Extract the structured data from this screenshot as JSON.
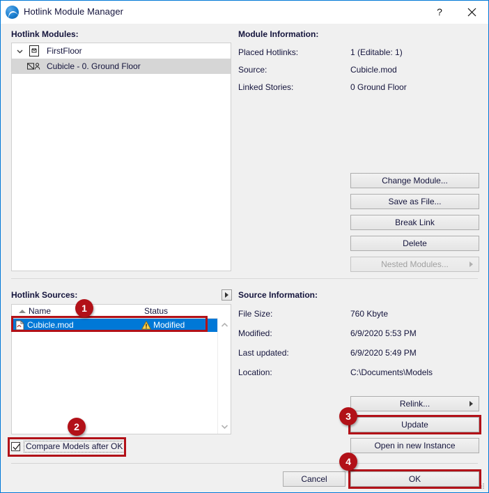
{
  "window": {
    "title": "Hotlink Module Manager",
    "icon": "archicad-logo-icon",
    "help_label": "?",
    "close_label": "✕"
  },
  "modules_panel": {
    "heading": "Hotlink Modules:",
    "tree": [
      {
        "label": "FirstFloor",
        "icon": "module-file-icon",
        "expanded": true,
        "selected": false
      },
      {
        "label": "Cubicle - 0. Ground Floor",
        "icon": "hotlink-instance-icon",
        "expanded": false,
        "selected": true
      }
    ]
  },
  "module_information": {
    "heading": "Module Information:",
    "rows": [
      {
        "label": "Placed Hotlinks:",
        "value": "1 (Editable: 1)"
      },
      {
        "label": "Source:",
        "value": "Cubicle.mod"
      },
      {
        "label": "Linked Stories:",
        "value": "0 Ground Floor"
      }
    ]
  },
  "module_buttons": [
    {
      "label": "Change Module...",
      "disabled": false,
      "caret": false
    },
    {
      "label": "Save as File...",
      "disabled": false,
      "caret": false
    },
    {
      "label": "Break Link",
      "disabled": false,
      "caret": false
    },
    {
      "label": "Delete",
      "disabled": false,
      "caret": false
    },
    {
      "label": "Nested Modules...",
      "disabled": true,
      "caret": true
    }
  ],
  "sources_panel": {
    "heading": "Hotlink Sources:",
    "expand_button": "expand-right-icon",
    "columns": [
      "Name",
      "Status"
    ],
    "sort_indicator": "sort-ascending-icon",
    "rows": [
      {
        "name": "Cubicle.mod",
        "status": "Modified",
        "status_icon": "warning-triangle-icon",
        "file_icon": "mod-file-icon",
        "selected": true
      }
    ],
    "scroll_up": "chevron-up-icon",
    "scroll_down": "chevron-down-icon"
  },
  "source_information": {
    "heading": "Source Information:",
    "rows": [
      {
        "label": "File Size:",
        "value": "760 Kbyte"
      },
      {
        "label": "Modified:",
        "value": "6/9/2020 5:53 PM"
      },
      {
        "label": "Last updated:",
        "value": "6/9/2020 5:49 PM"
      },
      {
        "label": "Location:",
        "value": "C:\\Documents\\Models"
      }
    ]
  },
  "source_buttons": [
    {
      "label": "Relink...",
      "disabled": false,
      "caret": true
    },
    {
      "label": "Update",
      "disabled": false,
      "caret": false
    },
    {
      "label": "Open in new Instance",
      "disabled": false,
      "caret": false
    }
  ],
  "compare_checkbox": {
    "label": "Compare Models after OK",
    "checked": true,
    "check_icon": "checkmark-icon"
  },
  "footer": {
    "cancel_label": "Cancel",
    "ok_label": "OK",
    "resize_grip": "resize-grip-icon"
  },
  "annotations": {
    "accent_color": "#b21118",
    "badges": [
      {
        "number": "1",
        "target": "sources-row-highlight"
      },
      {
        "number": "2",
        "target": "compare-models-checkbox"
      },
      {
        "number": "3",
        "target": "update-button"
      },
      {
        "number": "4",
        "target": "ok-button"
      }
    ]
  }
}
